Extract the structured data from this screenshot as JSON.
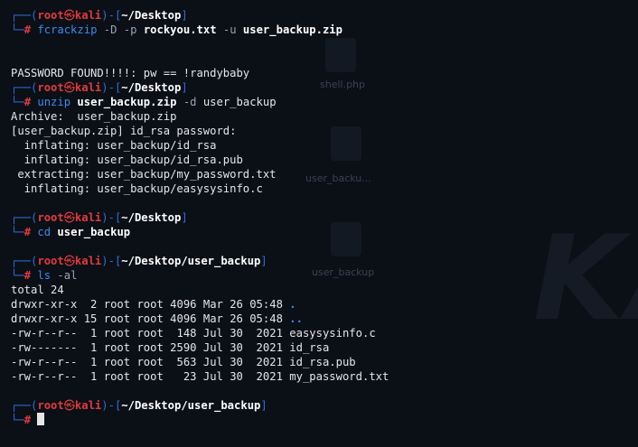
{
  "wallpaper": {
    "labels": [
      "shell.php",
      "user_backu...",
      "user_backup"
    ],
    "logo_text": "KAI"
  },
  "prompt": {
    "user": "root",
    "separator": "㉿",
    "host": "kali",
    "hash": "#"
  },
  "blocks": [
    {
      "path": "~/Desktop",
      "command": {
        "name": "fcrackzip",
        "parts": [
          "-D",
          "-p",
          "rockyou.txt",
          "-u",
          "user_backup.zip"
        ]
      },
      "output": [
        "",
        "",
        "PASSWORD FOUND!!!!: pw == !randybaby"
      ]
    },
    {
      "path": "~/Desktop",
      "command": {
        "name": "unzip",
        "parts": [
          "user_backup.zip",
          "-d",
          "user_backup"
        ]
      },
      "output": [
        "Archive:  user_backup.zip",
        "[user_backup.zip] id_rsa password:",
        "  inflating: user_backup/id_rsa",
        "  inflating: user_backup/id_rsa.pub",
        " extracting: user_backup/my_password.txt",
        "  inflating: user_backup/easysysinfo.c",
        ""
      ]
    },
    {
      "path": "~/Desktop",
      "command": {
        "name": "cd",
        "parts": [
          "user_backup"
        ]
      },
      "output": [
        ""
      ]
    },
    {
      "path": "~/Desktop/user_backup",
      "command": {
        "name": "ls",
        "parts": [
          "-al"
        ]
      },
      "output_total": "total 24",
      "listing": [
        {
          "perms": "drwxr-xr-x",
          "links": " 2",
          "owner": "root",
          "group": "root",
          "size": "4096",
          "date": "Mar 26 05:48",
          "name": ".",
          "is_dir": true
        },
        {
          "perms": "drwxr-xr-x",
          "links": "15",
          "owner": "root",
          "group": "root",
          "size": "4096",
          "date": "Mar 26 05:48",
          "name": "..",
          "is_dir": true
        },
        {
          "perms": "-rw-r--r--",
          "links": " 1",
          "owner": "root",
          "group": "root",
          "size": " 148",
          "date": "Jul 30  2021",
          "name": "easysysinfo.c",
          "is_dir": false
        },
        {
          "perms": "-rw-------",
          "links": " 1",
          "owner": "root",
          "group": "root",
          "size": "2590",
          "date": "Jul 30  2021",
          "name": "id_rsa",
          "is_dir": false
        },
        {
          "perms": "-rw-r--r--",
          "links": " 1",
          "owner": "root",
          "group": "root",
          "size": " 563",
          "date": "Jul 30  2021",
          "name": "id_rsa.pub",
          "is_dir": false
        },
        {
          "perms": "-rw-r--r--",
          "links": " 1",
          "owner": "root",
          "group": "root",
          "size": "  23",
          "date": "Jul 30  2021",
          "name": "my_password.txt",
          "is_dir": false
        }
      ]
    },
    {
      "path": "~/Desktop/user_backup",
      "command": null,
      "output": []
    }
  ],
  "colors": {
    "background": "#0b0f16",
    "frame": "#2f6fde",
    "user_host": "#e23b3b",
    "command": "#3b8cf0",
    "text": "#e6e6e6"
  }
}
